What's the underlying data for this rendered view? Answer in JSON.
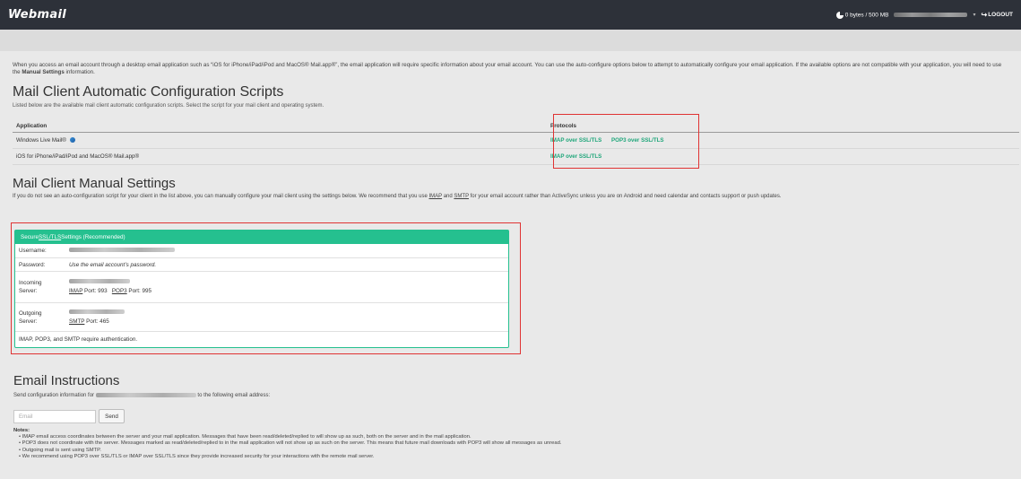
{
  "header": {
    "logo": "Webmail",
    "quota": "0 bytes / 500 MB",
    "logout": "LOGOUT"
  },
  "intro": {
    "text_before": "When you access an email account through a desktop email application such as “iOS for iPhone/iPad/iPod and MacOS® Mail.app®”, the email application will require specific information about your email account. You can use the auto-configure options below to attempt to automatically configure your email application. If the available options are not compatible with your application, you will need to use the ",
    "bold": "Manual Settings",
    "text_after": " information."
  },
  "auto_config": {
    "title": "Mail Client Automatic Configuration Scripts",
    "subtitle": "Listed below are the available mail client automatic configuration scripts. Select the script for your mail client and operating system.",
    "col_application": "Application",
    "col_protocols": "Protocols",
    "rows": [
      {
        "app": "Windows Live Mail®",
        "p1": "IMAP over SSL/TLS",
        "p2": "POP3 over SSL/TLS"
      },
      {
        "app": "iOS for iPhone/iPad/iPod and MacOS® Mail.app®",
        "p1": "IMAP over SSL/TLS",
        "p2": ""
      }
    ]
  },
  "manual": {
    "title": "Mail Client Manual Settings",
    "desc_1": "If you do not see an auto-configuration script for your client in the list above, you can manually configure your mail client using the settings below. We recommend that you use ",
    "imap": "IMAP",
    "and": " and ",
    "smtp": "SMTP",
    "desc_2": " for your email account rather than ActiveSync unless you are on Android and need calendar and contacts support or push updates.",
    "card": {
      "header_secure": "Secure ",
      "header_ssl": "SSL/TLS",
      "header_rest": " Settings (Recommended)",
      "username_label": "Username:",
      "password_label": "Password:",
      "password_value": "Use the email account’s password.",
      "incoming_label_1": "Incoming",
      "incoming_label_2": "Server:",
      "imap_label": "IMAP",
      "imap_port": " Port: 993",
      "pop3_label": "POP3",
      "pop3_port": " Port: 995",
      "outgoing_label_1": "Outgoing",
      "outgoing_label_2": "Server:",
      "smtp_label": "SMTP",
      "smtp_port": " Port: 465",
      "auth_note": "IMAP, POP3, and SMTP require authentication."
    }
  },
  "email_instructions": {
    "title": "Email Instructions",
    "desc_1": "Send configuration information for",
    "desc_2": "to the following email address:",
    "placeholder": "Email",
    "send_label": "Send"
  },
  "notes": {
    "heading": "Notes:",
    "items": [
      "IMAP email access coordinates between the server and your mail application. Messages that have been read/deleted/replied to will show up as such, both on the server and in the mail application.",
      "POP3 does not coordinate with the server. Messages marked as read/deleted/replied to in the mail application will not show up as such on the server. This means that future mail downloads with POP3 will show all messages as unread.",
      "Outgoing mail is sent using SMTP.",
      "We recommend using POP3 over SSL/TLS or IMAP over SSL/TLS since they provide increased security for your interactions with the remote mail server."
    ]
  },
  "colors": {
    "accent": "#25c08f",
    "link": "#1fa67a",
    "highlight": "#e03333",
    "topbar": "#2d3139"
  }
}
